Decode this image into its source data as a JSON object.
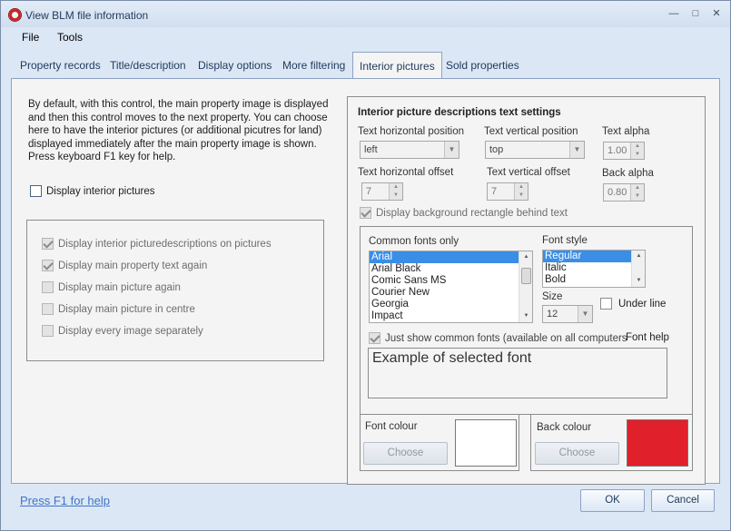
{
  "window": {
    "title": "View BLM file information",
    "minimize": "—",
    "maximize": "□",
    "close": "✕"
  },
  "menu": [
    "File",
    "Tools"
  ],
  "tabs": [
    "Property records",
    "Title/description",
    "Display options",
    "More filtering",
    "Interior pictures",
    "Sold properties"
  ],
  "active_tab": "Interior pictures",
  "left": {
    "description": "By default, with this control, the main property image is displayed and then this control moves to the next property.  You can choose here to have the interior pictures (or additional picutres for land) displayed immediately after the main property image is shown.  Press keyboard F1 key for help.",
    "display_interior": {
      "label": "Display interior pictures",
      "checked": false
    },
    "options": [
      {
        "label": "Display interior picturedescriptions on pictures",
        "checked": true
      },
      {
        "label": "Display main property text again",
        "checked": true
      },
      {
        "label": "Display main picture again",
        "checked": false
      },
      {
        "label": "Display main picture in centre",
        "checked": false
      },
      {
        "label": "Display every image separately",
        "checked": false
      }
    ]
  },
  "right": {
    "heading": "Interior picture descriptions text settings",
    "h_pos_label": "Text horizontal position",
    "h_pos_value": "left",
    "v_pos_label": "Text vertical position",
    "v_pos_value": "top",
    "alpha_label": "Text alpha",
    "alpha_value": "1.00",
    "h_off_label": "Text horizontal offset",
    "h_off_value": "7",
    "v_off_label": "Text vertical offset",
    "v_off_value": "7",
    "back_alpha_label": "Back alpha",
    "back_alpha_value": "0.80",
    "bg_rect": {
      "label": "Display background rectangle behind text",
      "checked": true
    },
    "fonts_label": "Common fonts only",
    "fonts": [
      "Arial",
      "Arial Black",
      "Comic Sans MS",
      "Courier New",
      "Georgia",
      "Impact"
    ],
    "selected_font": "Arial",
    "style_label": "Font style",
    "styles": [
      "Regular",
      "Italic",
      "Bold"
    ],
    "selected_style": "Regular",
    "size_label": "Size",
    "size_value": "12",
    "underline": {
      "label": "Under line",
      "checked": false
    },
    "common_fonts": {
      "label": "Just show common fonts (available on all computers",
      "checked": true
    },
    "font_help": "Font help",
    "example": "Example of selected font",
    "font_colour_label": "Font colour",
    "font_colour": "#ffffff",
    "back_colour_label": "Back colour",
    "back_colour": "#e0202a",
    "choose_label": "Choose"
  },
  "footer": {
    "help_link": "Press F1 for help",
    "ok": "OK",
    "cancel": "Cancel"
  }
}
